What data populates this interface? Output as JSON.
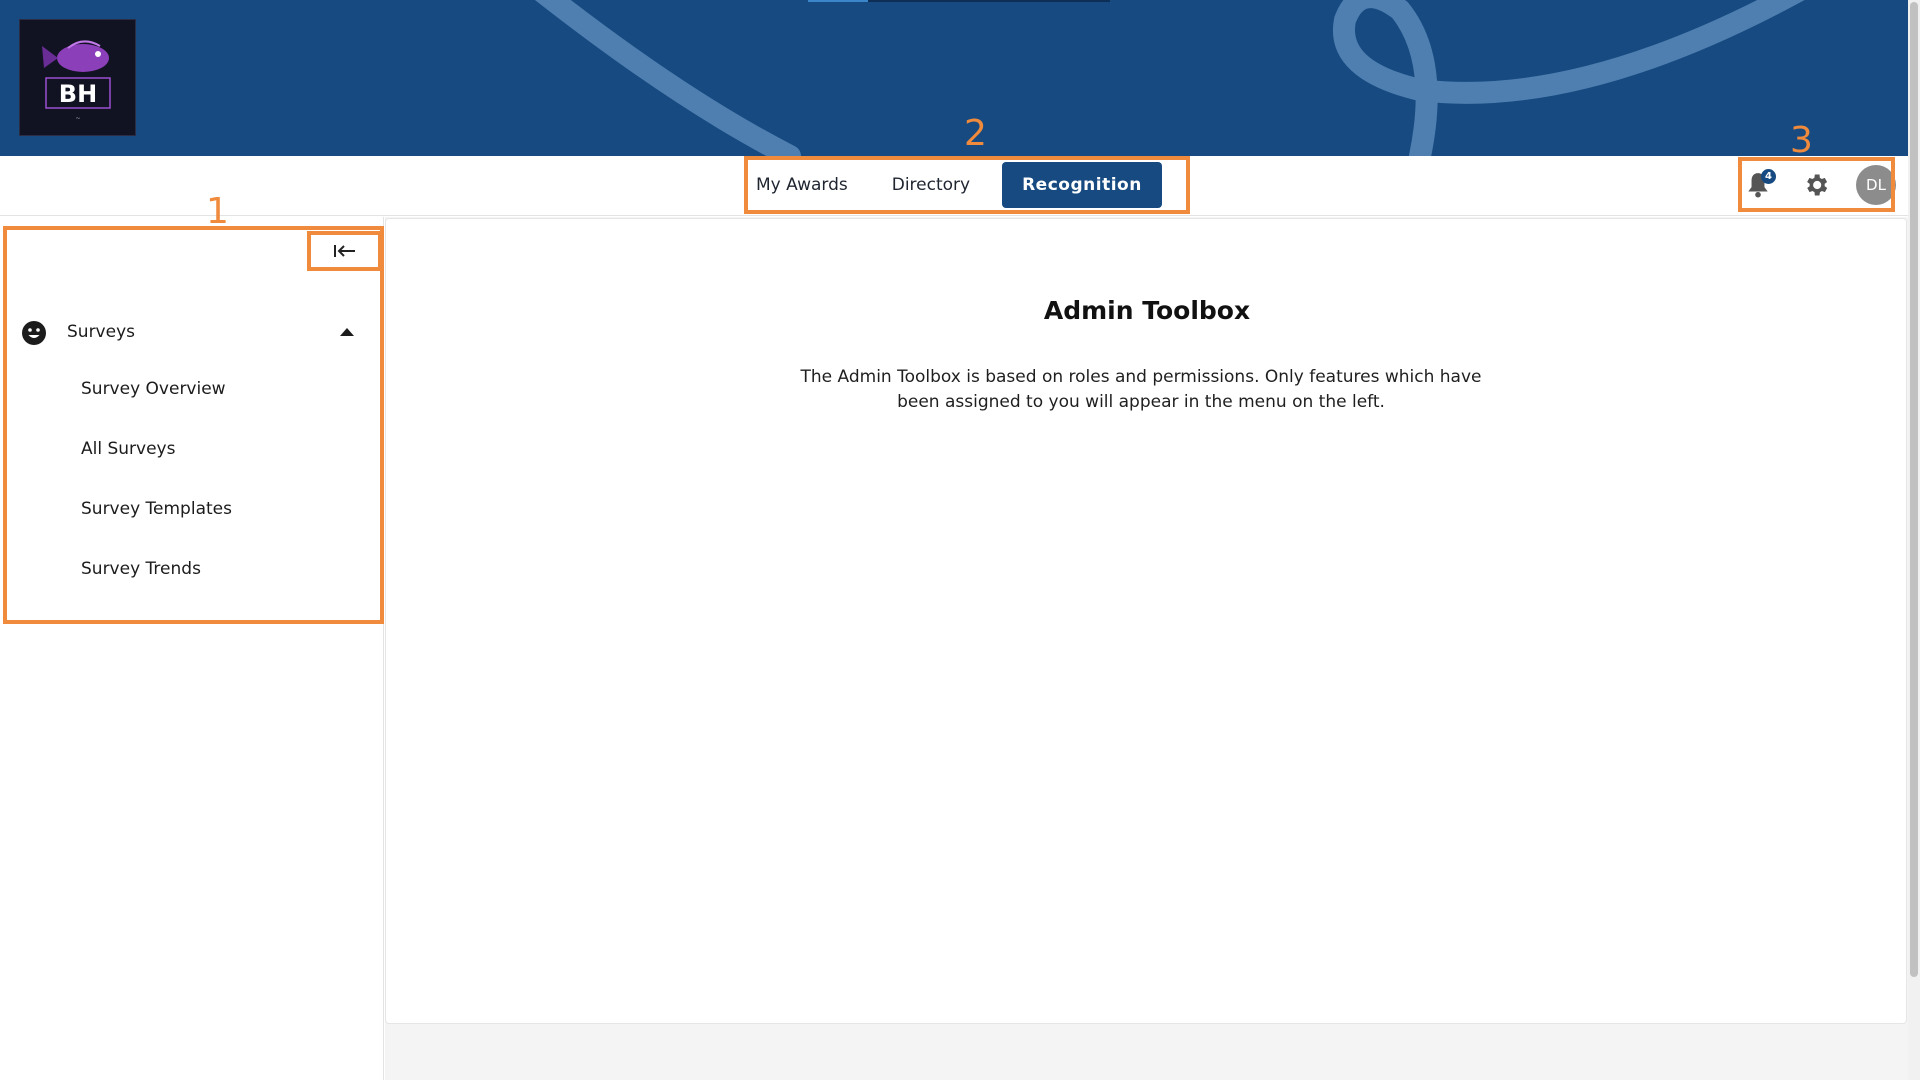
{
  "header": {
    "logo_name": "BH&H fish logo"
  },
  "nav": {
    "tabs": [
      {
        "label": "My Awards",
        "active": false
      },
      {
        "label": "Directory",
        "active": false
      },
      {
        "label": "Recognition",
        "active": true
      }
    ],
    "notification_count": "4",
    "avatar_initials": "DL"
  },
  "sidebar": {
    "collapse_icon": "collapse-left-icon",
    "group": {
      "label": "Surveys",
      "icon": "smiley-face-icon",
      "expanded": true
    },
    "items": [
      {
        "label": "Survey Overview"
      },
      {
        "label": "All Surveys"
      },
      {
        "label": "Survey Templates"
      },
      {
        "label": "Survey Trends"
      }
    ]
  },
  "main": {
    "title": "Admin Toolbox",
    "description": "The Admin Toolbox is based on roles and permissions. Only features which have been assigned to you will appear in the menu on the left."
  },
  "annotations": [
    "1",
    "2",
    "3"
  ],
  "colors": {
    "brand_blue": "#164a80",
    "annotation_orange": "#f08a3c"
  }
}
